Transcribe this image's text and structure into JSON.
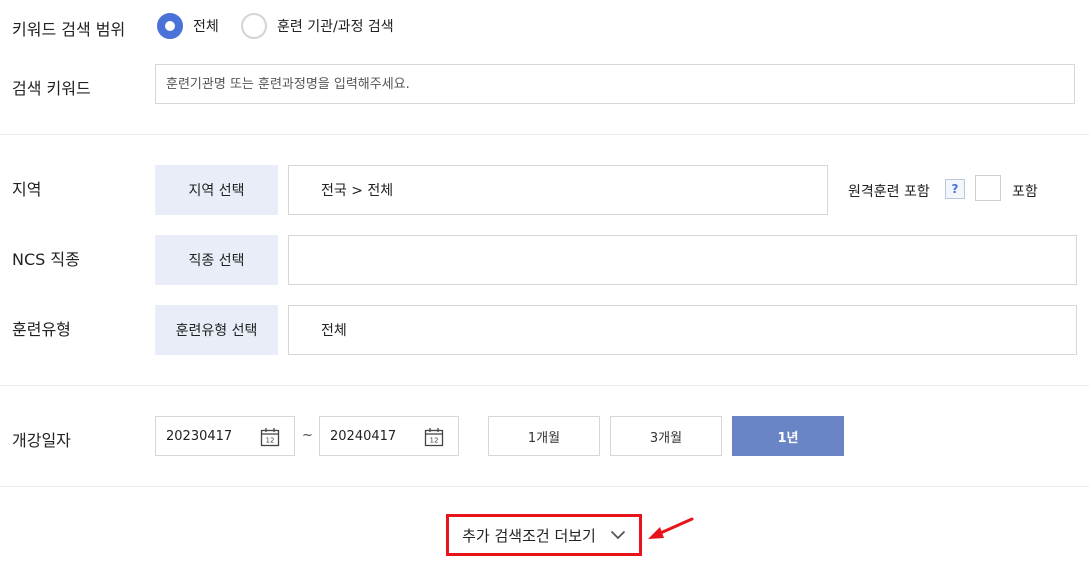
{
  "keyword_scope": {
    "label": "키워드 검색 범위",
    "options": [
      {
        "label": "전체",
        "selected": true
      },
      {
        "label": "훈련 기관/과정 검색",
        "selected": false
      }
    ]
  },
  "keyword": {
    "label": "검색 키워드",
    "placeholder": "훈련기관명 또는 훈련과정명을 입력해주세요."
  },
  "region": {
    "label": "지역",
    "button": "지역 선택",
    "value": "전국 > 전체",
    "remote_label": "원격훈련 포함",
    "help_icon": "?",
    "include_label": "포함"
  },
  "ncs": {
    "label": "NCS 직종",
    "button": "직종 선택",
    "value": ""
  },
  "training_type": {
    "label": "훈련유형",
    "button": "훈련유형 선택",
    "value": "전체"
  },
  "open_date": {
    "label": "개강일자",
    "start": "20230417",
    "separator": "~",
    "end": "20240417",
    "calendar_icon_text": "12",
    "periods": [
      {
        "label": "1개월",
        "active": false
      },
      {
        "label": "3개월",
        "active": false
      },
      {
        "label": "1년",
        "active": true
      }
    ]
  },
  "more_conditions": {
    "label": "추가 검색조건 더보기"
  },
  "colors": {
    "accent": "#4a72d8",
    "active_period": "#6a85c6",
    "select_button_bg": "#e8edf7",
    "highlight": "#e8141c"
  },
  "icons": {
    "calendar": "calendar-icon",
    "chevron": "chevron-down-icon",
    "arrow": "red-arrow-annotation-icon"
  }
}
